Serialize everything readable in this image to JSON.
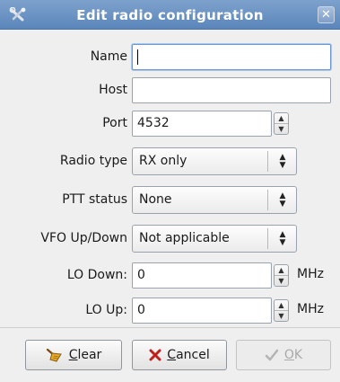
{
  "window": {
    "title": "Edit radio configuration",
    "close_glyph": "✕",
    "app_icon": "tools-icon"
  },
  "fields": {
    "name": {
      "label": "Name",
      "value": ""
    },
    "host": {
      "label": "Host",
      "value": ""
    },
    "port": {
      "label": "Port",
      "value": "4532"
    },
    "radio_type": {
      "label": "Radio type",
      "selected": "RX only"
    },
    "ptt_status": {
      "label": "PTT status",
      "selected": "None"
    },
    "vfo_updown": {
      "label": "VFO Up/Down",
      "selected": "Not applicable"
    },
    "lo_down": {
      "label": "LO Down:",
      "value": "0",
      "unit": "MHz"
    },
    "lo_up": {
      "label": "LO Up:",
      "value": "0",
      "unit": "MHz"
    }
  },
  "buttons": {
    "clear": {
      "mnemonic": "C",
      "rest": "lear",
      "icon": "broom-icon",
      "enabled": true
    },
    "cancel": {
      "mnemonic": "C",
      "rest": "ancel",
      "icon": "cancel-x-icon",
      "enabled": true
    },
    "ok": {
      "mnemonic": "O",
      "rest": "K",
      "icon": "checkmark-icon",
      "enabled": false
    }
  },
  "colors": {
    "titlebar": "#6a93c4",
    "focus_ring": "#6c9ad1",
    "cancel_icon": "#c0201b",
    "clear_icon": "#e0a92a"
  }
}
